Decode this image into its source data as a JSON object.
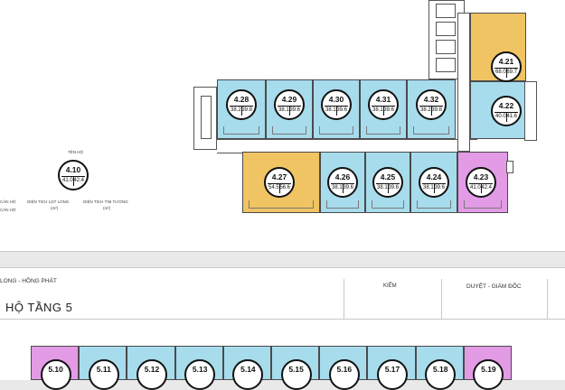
{
  "colors": {
    "blue": "#a7dcec",
    "yellow": "#f0c463",
    "pink": "#e39be6"
  },
  "floor4_row1": [
    {
      "code": "4.28",
      "a1": "38.2",
      "a2": "39.8"
    },
    {
      "code": "4.29",
      "a1": "38.1",
      "a2": "39.6"
    },
    {
      "code": "4.30",
      "a1": "38.1",
      "a2": "39.6"
    },
    {
      "code": "4.31",
      "a1": "38.1",
      "a2": "39.6"
    },
    {
      "code": "4.32",
      "a1": "38.2",
      "a2": "39.8"
    }
  ],
  "floor4_row2": [
    {
      "code": "4.27",
      "a1": "54.5",
      "a2": "56.6"
    },
    {
      "code": "4.26",
      "a1": "38.1",
      "a2": "39.6"
    },
    {
      "code": "4.25",
      "a1": "38.1",
      "a2": "39.6"
    },
    {
      "code": "4.24",
      "a1": "38.1",
      "a2": "39.6"
    },
    {
      "code": "4.23",
      "a1": "41.0",
      "a2": "42.4"
    }
  ],
  "floor4_right": [
    {
      "code": "4.21",
      "a1": "68.0",
      "a2": "69.7"
    },
    {
      "code": "4.22",
      "a1": "40.0",
      "a2": "41.6"
    }
  ],
  "legend": {
    "label_top": "TÊN HỘ",
    "code": "4.10",
    "a1": "41.0",
    "a2": "42.4",
    "left_1": "CĂN HỘ",
    "left_2": "CĂN HỘ",
    "label_left": "DIỆN TÍCH LỌT LÒNG",
    "label_left_unit": "(m²)",
    "label_right": "DIỆN TÍCH TIM TƯỜNG",
    "label_right_unit": "(m²)"
  },
  "titleblock": {
    "company": "LONG - HỒNG PHÁT",
    "check": "KIỂM",
    "approve": "DUYỆT - GIÁM ĐỐC",
    "title": "HỘ TẦNG  5"
  },
  "floor5": [
    "5.10",
    "5.11",
    "5.12",
    "5.13",
    "5.14",
    "5.15",
    "5.16",
    "5.17",
    "5.18",
    "5.19"
  ]
}
